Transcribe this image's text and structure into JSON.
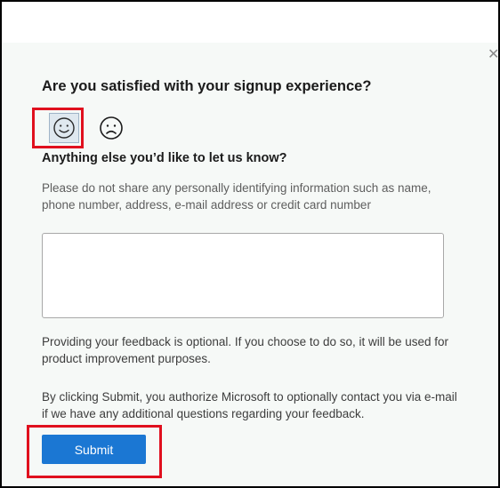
{
  "survey": {
    "question": "Are you satisfied with your signup experience?",
    "close_icon": "close-icon",
    "ratings": [
      {
        "icon": "smiley-face-icon",
        "selected": true
      },
      {
        "icon": "frowning-face-icon",
        "selected": false
      }
    ],
    "subheading": "Anything else you’d like to let us know?",
    "privacy_note": "Please do not share any personally identifying information such as name, phone number, address, e-mail address or credit card number",
    "feedback_value": "",
    "optional_note": "Providing your feedback is optional. If you choose to do so, it will be used for product improvement purposes.",
    "consent_note": "By clicking Submit, you authorize Microsoft to optionally contact you via e-mail if we have any additional questions regarding your feedback.",
    "submit_label": "Submit"
  },
  "colors": {
    "highlight": "#e0101e",
    "primary_button": "#1b77d3",
    "dialog_background": "#f6f9f7"
  }
}
